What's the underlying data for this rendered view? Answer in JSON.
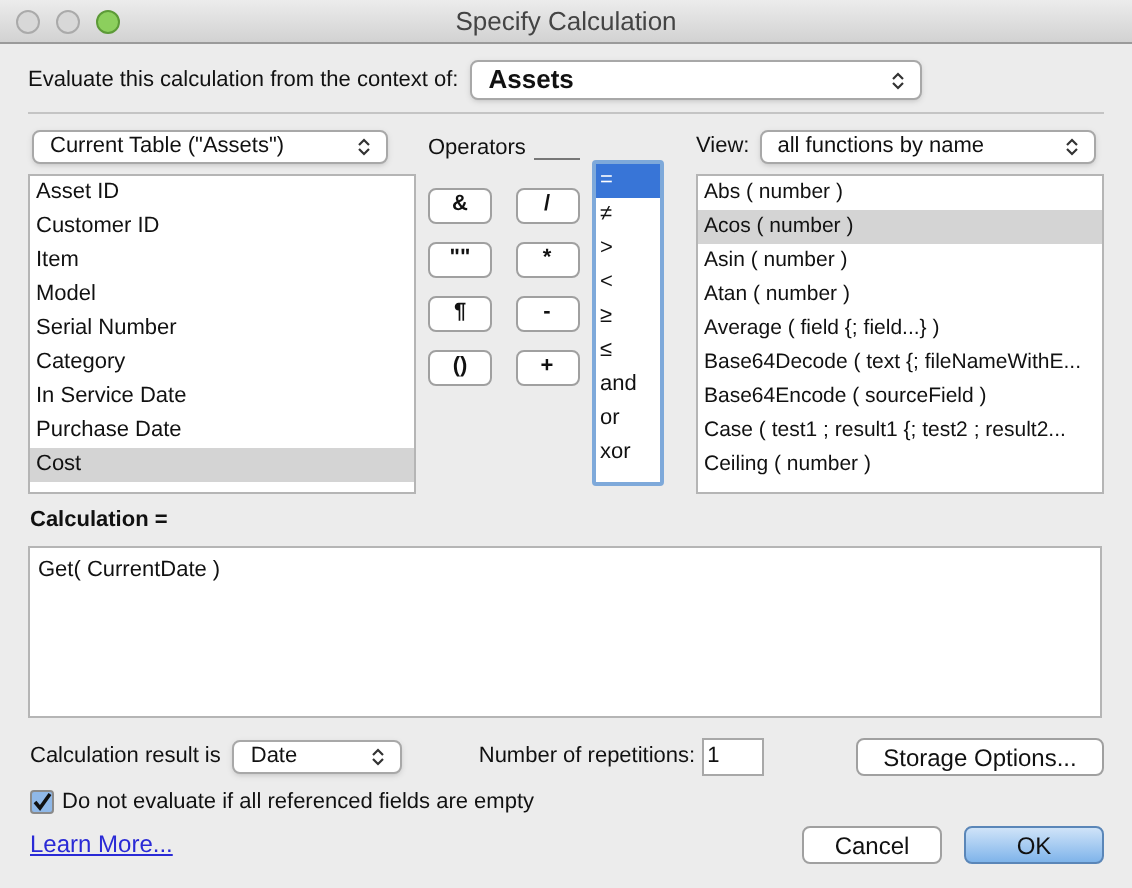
{
  "window": {
    "title": "Specify Calculation"
  },
  "context": {
    "label": "Evaluate this calculation from the context of:",
    "value": "Assets"
  },
  "table_selector": {
    "value": "Current Table (\"Assets\")"
  },
  "fields": [
    {
      "label": "Asset ID",
      "selected": false
    },
    {
      "label": "Customer ID",
      "selected": false
    },
    {
      "label": "Item",
      "selected": false
    },
    {
      "label": "Model",
      "selected": false
    },
    {
      "label": "Serial Number",
      "selected": false
    },
    {
      "label": "Category",
      "selected": false
    },
    {
      "label": "In Service Date",
      "selected": false
    },
    {
      "label": "Purchase Date",
      "selected": false
    },
    {
      "label": "Cost",
      "selected": true
    }
  ],
  "operators": {
    "label": "Operators",
    "buttons": [
      "&",
      "/",
      "\"\"",
      "*",
      "¶",
      "-",
      "()",
      "+"
    ],
    "list": [
      {
        "label": "=",
        "selected": true
      },
      {
        "label": "≠",
        "selected": false
      },
      {
        "label": ">",
        "selected": false
      },
      {
        "label": "<",
        "selected": false
      },
      {
        "label": "≥",
        "selected": false
      },
      {
        "label": "≤",
        "selected": false
      },
      {
        "label": "and",
        "selected": false
      },
      {
        "label": "or",
        "selected": false
      },
      {
        "label": "xor",
        "selected": false
      }
    ]
  },
  "view": {
    "label": "View:",
    "value": "all functions by name"
  },
  "functions": [
    {
      "label": "Abs ( number )",
      "selected": false
    },
    {
      "label": "Acos ( number )",
      "selected": true
    },
    {
      "label": "Asin ( number )",
      "selected": false
    },
    {
      "label": "Atan ( number )",
      "selected": false
    },
    {
      "label": "Average ( field {; field...} )",
      "selected": false
    },
    {
      "label": "Base64Decode ( text {; fileNameWithE...",
      "selected": false
    },
    {
      "label": "Base64Encode ( sourceField )",
      "selected": false
    },
    {
      "label": "Case ( test1 ; result1 {; test2 ; result2...",
      "selected": false
    },
    {
      "label": "Ceiling ( number )",
      "selected": false
    }
  ],
  "calculation": {
    "label": "Calculation =",
    "value": "Get( CurrentDate )"
  },
  "result_type": {
    "label": "Calculation result is",
    "value": "Date"
  },
  "repetitions": {
    "label": "Number of repetitions:",
    "value": "1"
  },
  "storage_button": "Storage Options...",
  "do_not_evaluate": {
    "label": "Do not evaluate if all referenced fields are empty",
    "checked": true
  },
  "learn_more": "Learn More...",
  "buttons": [
    {
      "label": "Cancel",
      "kind": "normal"
    },
    {
      "label": "OK",
      "kind": "default"
    }
  ]
}
